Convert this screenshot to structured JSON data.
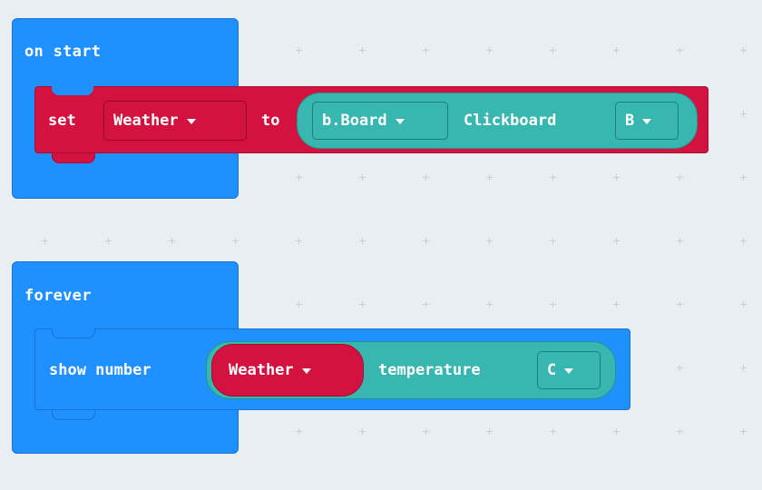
{
  "blocks": {
    "on_start": {
      "label": "on start",
      "color": "#1e90ff",
      "set_block": {
        "color": "#d4123f",
        "keyword_set": "set",
        "variable": "Weather",
        "keyword_to": "to",
        "value_block": {
          "color": "#37b7b0",
          "board_dropdown": "b.Board",
          "label": "Clickboard",
          "slot_dropdown": "B"
        }
      }
    },
    "forever": {
      "label": "forever",
      "color": "#1e90ff",
      "show_number": {
        "label": "show number",
        "reporter": {
          "color": "#37b7b0",
          "variable": "Weather",
          "property": "temperature",
          "unit_dropdown": "C"
        }
      }
    }
  },
  "workspace": {
    "background": "#e9eef3",
    "grid_color": "#c7cfd8"
  },
  "icons": {
    "dropdown": "triangle-down"
  }
}
